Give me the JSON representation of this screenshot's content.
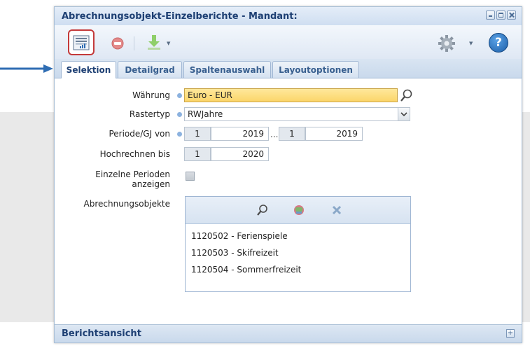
{
  "window": {
    "title": "Abrechnungsobjekt-Einzelberichte - Mandant:"
  },
  "toolbar": {
    "buttons": [
      {
        "icon": "report-icon"
      },
      {
        "icon": "stop-icon"
      },
      {
        "icon": "export-icon"
      },
      {
        "icon": "gear-icon"
      },
      {
        "icon": "help-icon"
      }
    ],
    "help_label": "?"
  },
  "tabs": [
    {
      "label": "Selektion",
      "active": true
    },
    {
      "label": "Detailgrad",
      "active": false
    },
    {
      "label": "Spaltenauswahl",
      "active": false
    },
    {
      "label": "Layoutoptionen",
      "active": false
    }
  ],
  "form": {
    "waehrung": {
      "label": "Währung",
      "value": "Euro - EUR"
    },
    "rastertyp": {
      "label": "Rastertyp",
      "value": "RWJahre"
    },
    "periode": {
      "label": "Periode/GJ von",
      "from_period": "1",
      "from_year": "2019",
      "separator": "...",
      "to_period": "1",
      "to_year": "2019"
    },
    "hochrechnen": {
      "label": "Hochrechnen bis",
      "period": "1",
      "year": "2020"
    },
    "einzelne_perioden": {
      "label_line1": "Einzelne Perioden",
      "label_line2": "anzeigen",
      "checked": false
    },
    "abrechnungsobjekte": {
      "label": "Abrechnungsobjekte",
      "items": [
        "1120502 - Ferienspiele",
        "1120503 - Skifreizeit",
        "1120504 - Sommerfreizeit"
      ]
    }
  },
  "footer": {
    "title": "Berichtsansicht",
    "expand_label": "+"
  },
  "colors": {
    "title_text": "#1d3f73",
    "highlight_field": "#fbd56a",
    "arrow": "#2f6db3",
    "report_button_border": "#c43a3a"
  }
}
